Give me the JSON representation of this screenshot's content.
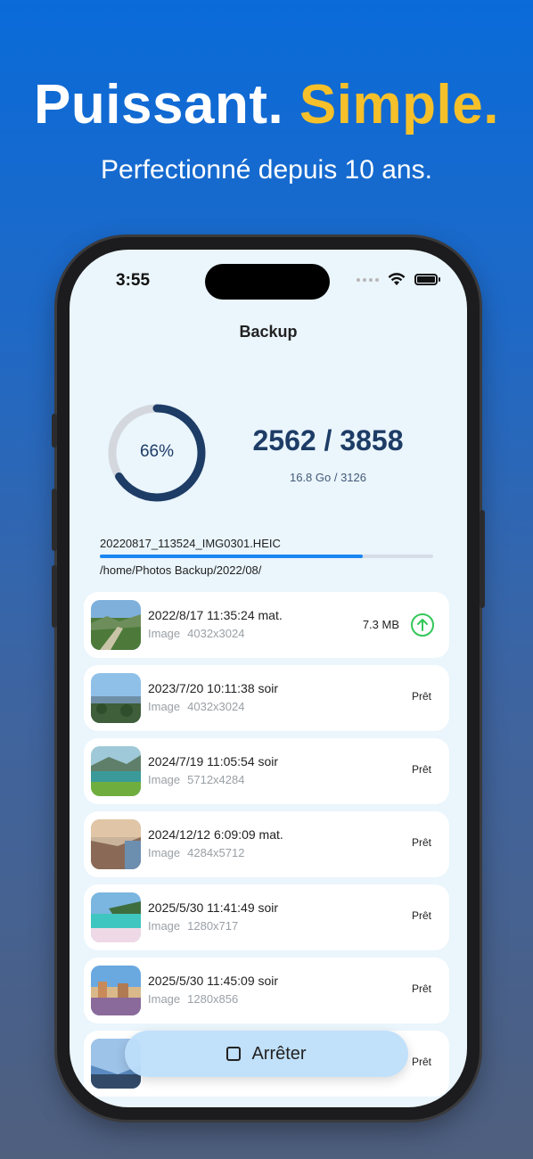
{
  "promo": {
    "headline_part1": "Puissant.",
    "headline_part2": "Simple.",
    "subheadline": "Perfectionné depuis 10 ans."
  },
  "status_bar": {
    "time": "3:55"
  },
  "nav": {
    "title": "Backup"
  },
  "summary": {
    "percent_label": "66%",
    "percent_value": 0.66,
    "count": "2562 / 3858",
    "size_info": "16.8 Go / 3126"
  },
  "current_file": {
    "name": "20220817_113524_IMG0301.HEIC",
    "progress": 0.79,
    "path": "/home/Photos Backup/2022/08/"
  },
  "items": [
    {
      "date": "2022/8/17 11:35:24 mat.",
      "type": "Image",
      "dims": "4032x3024",
      "size": "7.3 MB",
      "status": ""
    },
    {
      "date": "2023/7/20 10:11:38 soir",
      "type": "Image",
      "dims": "4032x3024",
      "size": "",
      "status": "Prêt"
    },
    {
      "date": "2024/7/19 11:05:54 soir",
      "type": "Image",
      "dims": "5712x4284",
      "size": "",
      "status": "Prêt"
    },
    {
      "date": "2024/12/12 6:09:09 mat.",
      "type": "Image",
      "dims": "4284x5712",
      "size": "",
      "status": "Prêt"
    },
    {
      "date": "2025/5/30 11:41:49 soir",
      "type": "Image",
      "dims": "1280x717",
      "size": "",
      "status": "Prêt"
    },
    {
      "date": "2025/5/30 11:45:09 soir",
      "type": "Image",
      "dims": "1280x856",
      "size": "",
      "status": "Prêt"
    },
    {
      "date": "",
      "type": "",
      "dims": "",
      "size": "",
      "status": "Prêt"
    }
  ],
  "stop_button": {
    "label": "Arrêter",
    "icon": "stop-square-icon"
  },
  "colors": {
    "accent_yellow": "#f6c02a",
    "ring_progress": "#1d3c66",
    "ring_track": "#d4d8de",
    "progress_fill": "#1a86f2",
    "upload_green": "#34c759"
  }
}
